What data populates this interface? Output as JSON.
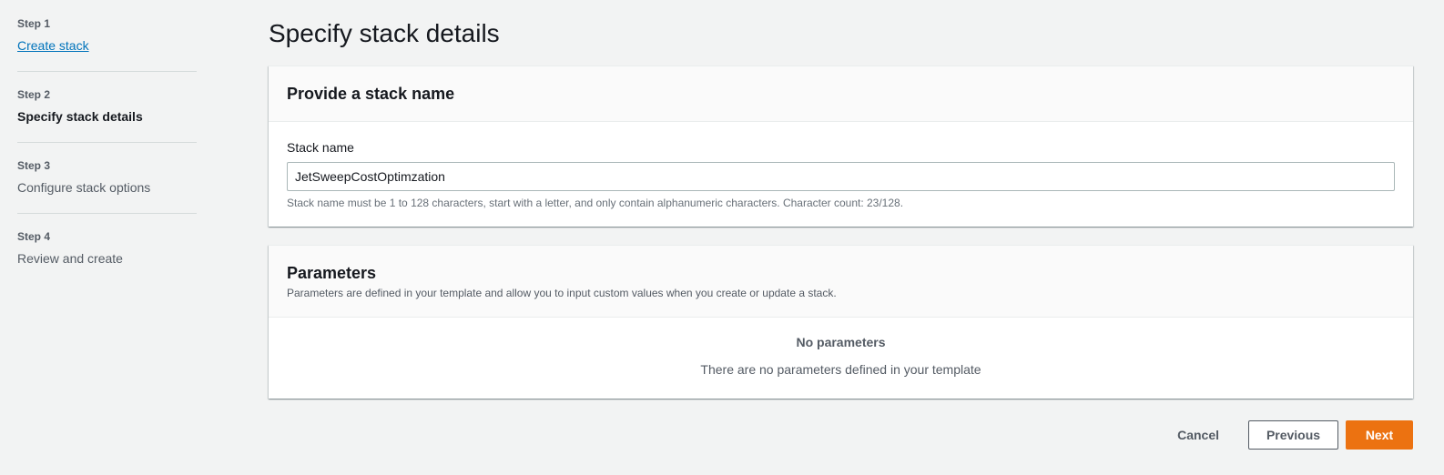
{
  "wizard": {
    "steps": [
      {
        "label": "Step 1",
        "title": "Create stack"
      },
      {
        "label": "Step 2",
        "title": "Specify stack details"
      },
      {
        "label": "Step 3",
        "title": "Configure stack options"
      },
      {
        "label": "Step 4",
        "title": "Review and create"
      }
    ]
  },
  "page": {
    "title": "Specify stack details"
  },
  "stack_name_section": {
    "header": "Provide a stack name",
    "field_label": "Stack name",
    "value": "JetSweepCostOptimzation",
    "hint": "Stack name must be 1 to 128 characters, start with a letter, and only contain alphanumeric characters. Character count: 23/128."
  },
  "parameters_section": {
    "header": "Parameters",
    "description": "Parameters are defined in your template and allow you to input custom values when you create or update a stack.",
    "empty_title": "No parameters",
    "empty_text": "There are no parameters defined in your template"
  },
  "actions": {
    "cancel": "Cancel",
    "previous": "Previous",
    "next": "Next"
  },
  "colors": {
    "primary": "#ec7211",
    "link": "#0073bb",
    "background": "#f2f3f3"
  }
}
